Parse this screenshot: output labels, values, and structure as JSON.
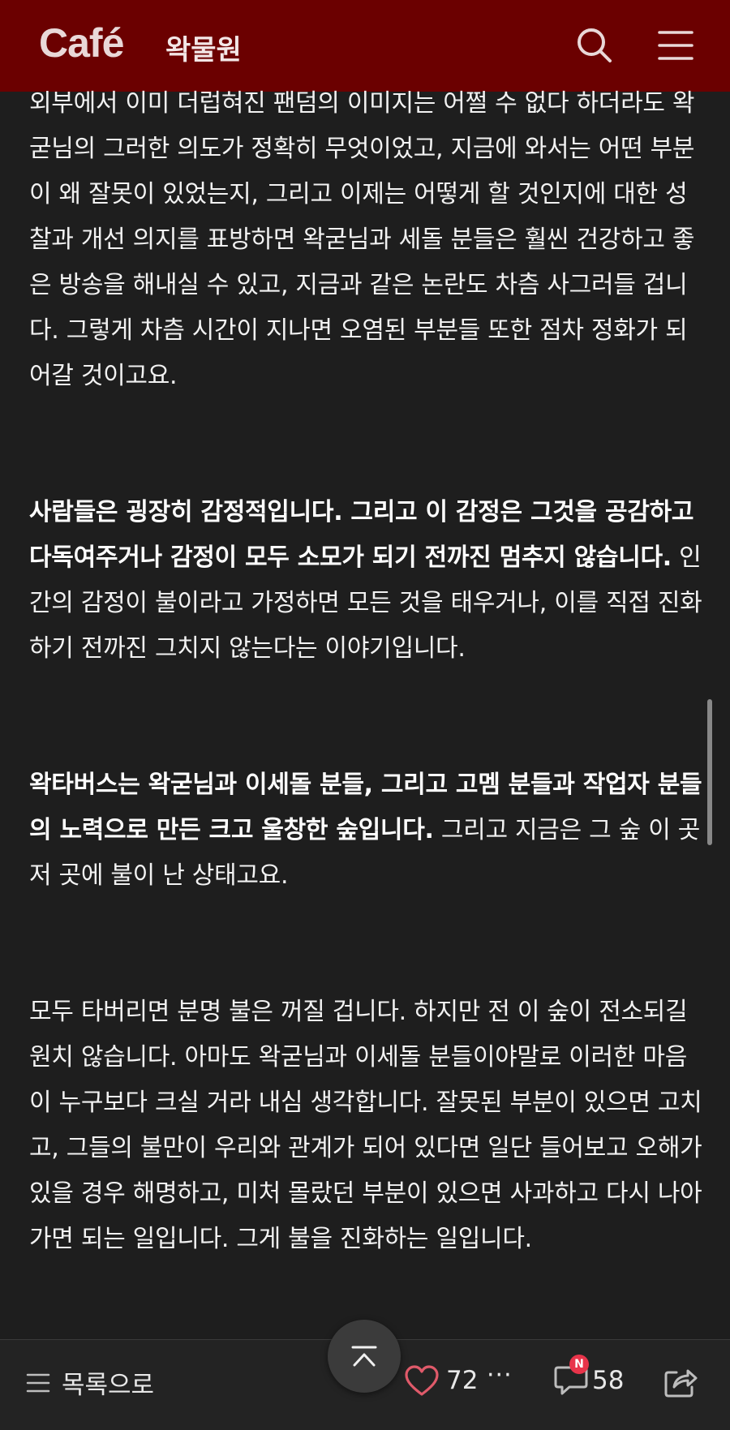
{
  "header": {
    "brand": "Café",
    "cafe_name": "왁물원"
  },
  "article": {
    "p1": "외부에서 이미 더럽혀진 팬덤의 이미지는 어쩔 수 없다 하더라도 왁굳님의 그러한 의도가 정확히 무엇이었고, 지금에 와서는 어떤 부분이 왜 잘못이 있었는지, 그리고 이제는 어떻게 할 것인지에 대한 성찰과 개선 의지를 표방하면 왁굳님과 세돌 분들은 훨씬 건강하고 좋은 방송을 해내실 수 있고, 지금과 같은 논란도 차츰 사그러들 겁니다. 그렇게 차츰 시간이 지나면 오염된 부분들 또한 점차 정화가 되어갈 것이고요.",
    "p2_bold": "사람들은 굉장히 감정적입니다. 그리고 이 감정은 그것을 공감하고 다독여주거나 감정이 모두 소모가 되기 전까진 멈추지 않습니다.",
    "p2_rest": " 인간의 감정이 불이라고 가정하면 모든 것을 태우거나, 이를 직접 진화하기 전까진 그치지 않는다는 이야기입니다.",
    "p3_bold": "왁타버스는 왁굳님과 이세돌 분들, 그리고 고멤 분들과 작업자 분들의 노력으로 만든 크고 울창한 숲입니다.",
    "p3_rest": " 그리고 지금은 그 숲 이 곳 저 곳에 불이 난 상태고요.",
    "p4": "모두 타버리면 분명 불은 꺼질 겁니다. 하지만 전 이 숲이 전소되길 원치 않습니다. 아마도 왁굳님과 이세돌 분들이야말로 이러한 마음이 누구보다 크실 거라 내심 생각합니다. 잘못된 부분이 있으면 고치고, 그들의 불만이 우리와 관계가 되어 있다면 일단 들어보고 오해가 있을 경우 해명하고, 미처 몰랐던 부분이 있으면 사과하고 다시 나아가면 되는 일입니다. 그게 불을 진화하는 일입니다."
  },
  "bottom_bar": {
    "list_label": "목록으로",
    "like_count": "72",
    "more": "···",
    "comment_count": "58",
    "new_badge": "N"
  },
  "icons": {
    "search": "search-icon",
    "menu": "hamburger-menu-icon",
    "list": "list-icon",
    "like": "heart-icon",
    "comment": "comment-icon",
    "share": "share-icon",
    "top": "chevron-up-icon"
  },
  "colors": {
    "header_bg": "#6b0000",
    "page_bg": "#1e1e1e",
    "badge": "#e8344a",
    "like": "#e05a6a"
  }
}
